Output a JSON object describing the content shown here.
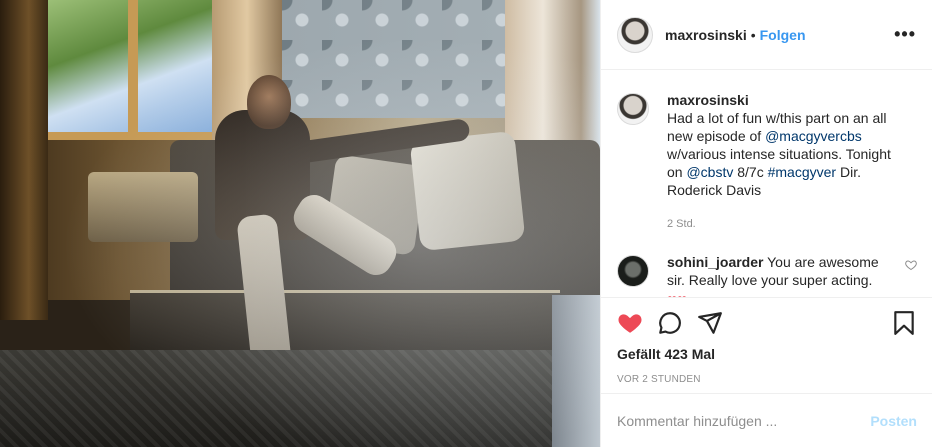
{
  "header": {
    "username": "maxrosinski",
    "separator": "•",
    "follow_label": "Folgen",
    "more_label": "•••"
  },
  "caption": {
    "username": "maxrosinski",
    "text_1": "Had a lot of fun w/this part on an all new episode of ",
    "mention_1": "@macgyvercbs",
    "text_2": " w/various intense situations. Tonight on ",
    "mention_2": "@cbstv",
    "text_3": " 8/7c ",
    "hashtag": "#macgyver",
    "text_4": " Dir. Roderick Davis",
    "time": "2 Std."
  },
  "comments": [
    {
      "username": "sohini_joarder",
      "text": " You are awesome sir. Really love your super acting.",
      "extra": "❤❤ "
    }
  ],
  "actions": {
    "like_icon": "heart-filled-icon",
    "comment_icon": "comment-icon",
    "share_icon": "share-icon",
    "save_icon": "bookmark-icon",
    "likes_text": "Gefällt 423 Mal",
    "time_text": "VOR 2 STUNDEN"
  },
  "add_comment": {
    "placeholder": "Kommentar hinzufügen ...",
    "post_label": "Posten"
  },
  "colors": {
    "link": "#3897f0",
    "mention": "#00376b",
    "like": "#ed4956",
    "post_disabled": "#b2dffc"
  }
}
